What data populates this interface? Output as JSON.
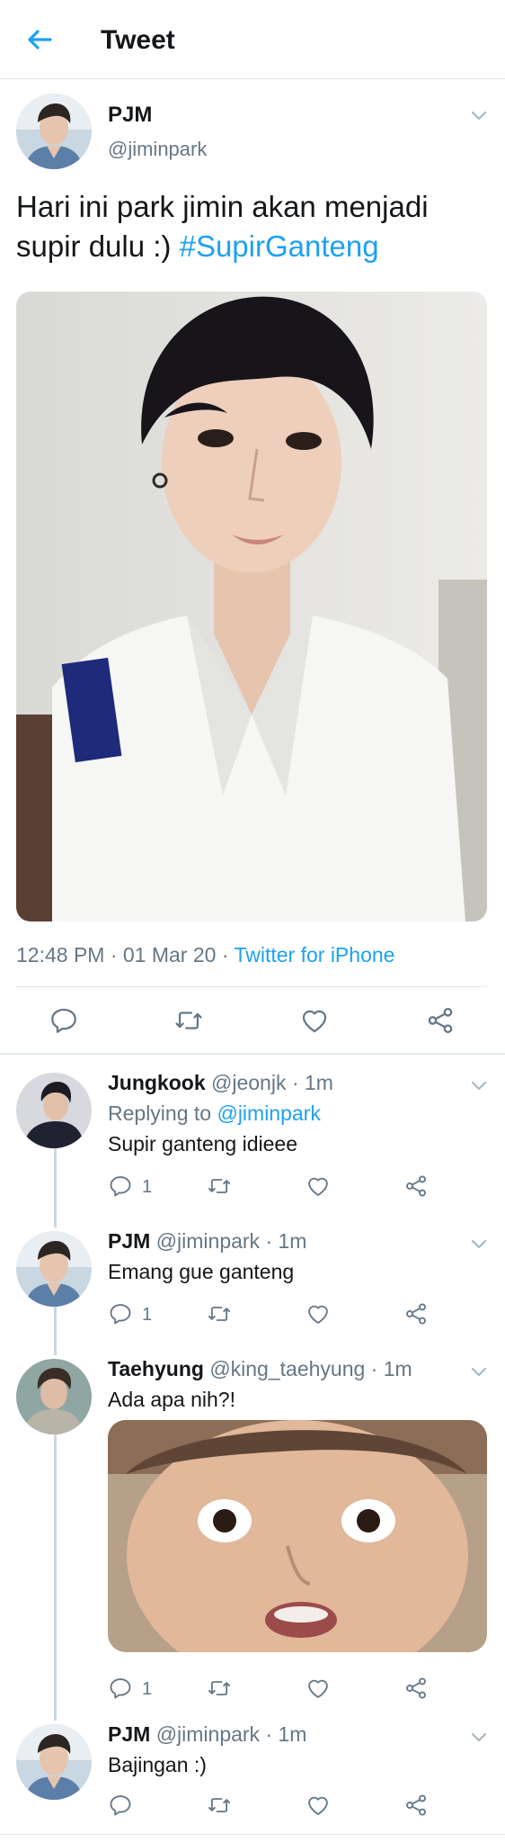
{
  "header": {
    "title": "Tweet"
  },
  "tweet": {
    "name": "PJM",
    "handle": "@jiminpark",
    "text_plain": "Hari ini park jimin akan menjadi supir dulu :) ",
    "hashtag": "#SupirGanteng",
    "timestamp": "12:48 PM · 01 Mar 20 · ",
    "source": "Twitter for iPhone"
  },
  "replies": [
    {
      "name": "Jungkook",
      "meta": "@jeonjk · 1m",
      "replying_to_label": "Replying to ",
      "replying_to": "@jiminpark",
      "text": "Supir ganteng idieee",
      "reply_count": "1"
    },
    {
      "name": "PJM",
      "meta": "@jiminpark · 1m",
      "text": "Emang gue ganteng",
      "reply_count": "1"
    },
    {
      "name": "Taehyung",
      "meta": "@king_taehyung · 1m",
      "text": "Ada apa nih?!",
      "reply_count": "1"
    },
    {
      "name": "PJM",
      "meta": "@jiminpark · 1m",
      "text": "Bajingan :)"
    }
  ],
  "colors": {
    "accent": "#1da1f2",
    "secondary_text": "#657786",
    "divider": "#e1e8ed"
  },
  "icons": {
    "back": "back-arrow-icon",
    "chevron": "chevron-down-icon",
    "reply": "reply-icon",
    "retweet": "retweet-icon",
    "like": "heart-icon",
    "share": "share-icon"
  }
}
